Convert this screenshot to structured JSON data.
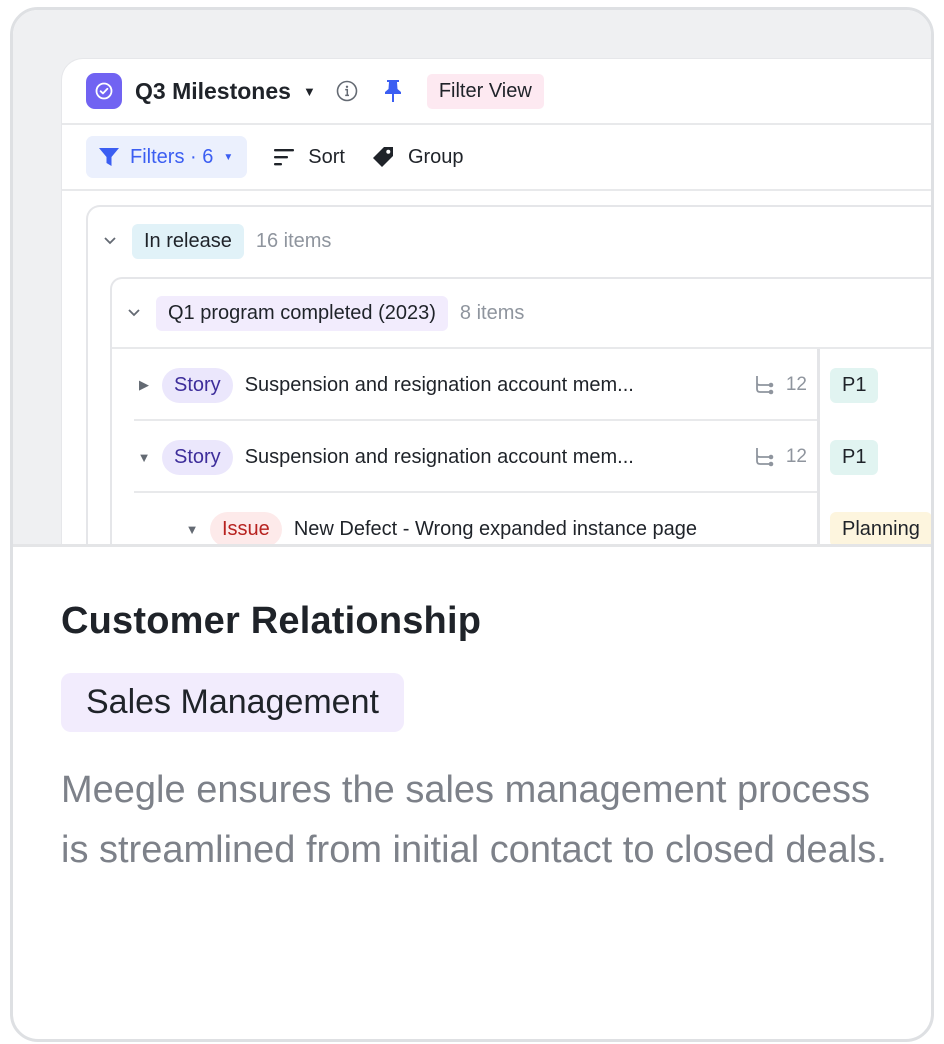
{
  "preview": {
    "view_title": "Q3 Milestones",
    "filter_view_badge": "Filter View",
    "toolbar": {
      "filters_label": "Filters · 6",
      "sort_label": "Sort",
      "group_label": "Group"
    },
    "group": {
      "label": "In release",
      "count": "16 items",
      "subgroup": {
        "label": "Q1 program completed (2023)",
        "count": "8 items",
        "rows": [
          {
            "expanded": false,
            "type": "Story",
            "title": "Suspension and resignation account mem...",
            "subtask_count": "12",
            "field": "P1"
          },
          {
            "expanded": true,
            "type": "Story",
            "title": "Suspension and resignation account mem...",
            "subtask_count": "12",
            "field": "P1"
          },
          {
            "expanded": true,
            "type": "Issue",
            "title": "New Defect - Wrong expanded instance page",
            "subtask_count": "",
            "field": "Planning"
          }
        ]
      }
    }
  },
  "card": {
    "heading": "Customer Relationship",
    "category": "Sales Management",
    "description": "Meegle ensures the sales management process is streamlined from initial contact to closed deals."
  },
  "colors": {
    "accent_purple": "#7163f2",
    "filter_blue": "#3b5ef2",
    "story_tag": "#ebe7fc",
    "issue_tag": "#fdeaea",
    "priority_badge": "#e1f4f1",
    "status_badge": "#fdf5de"
  }
}
